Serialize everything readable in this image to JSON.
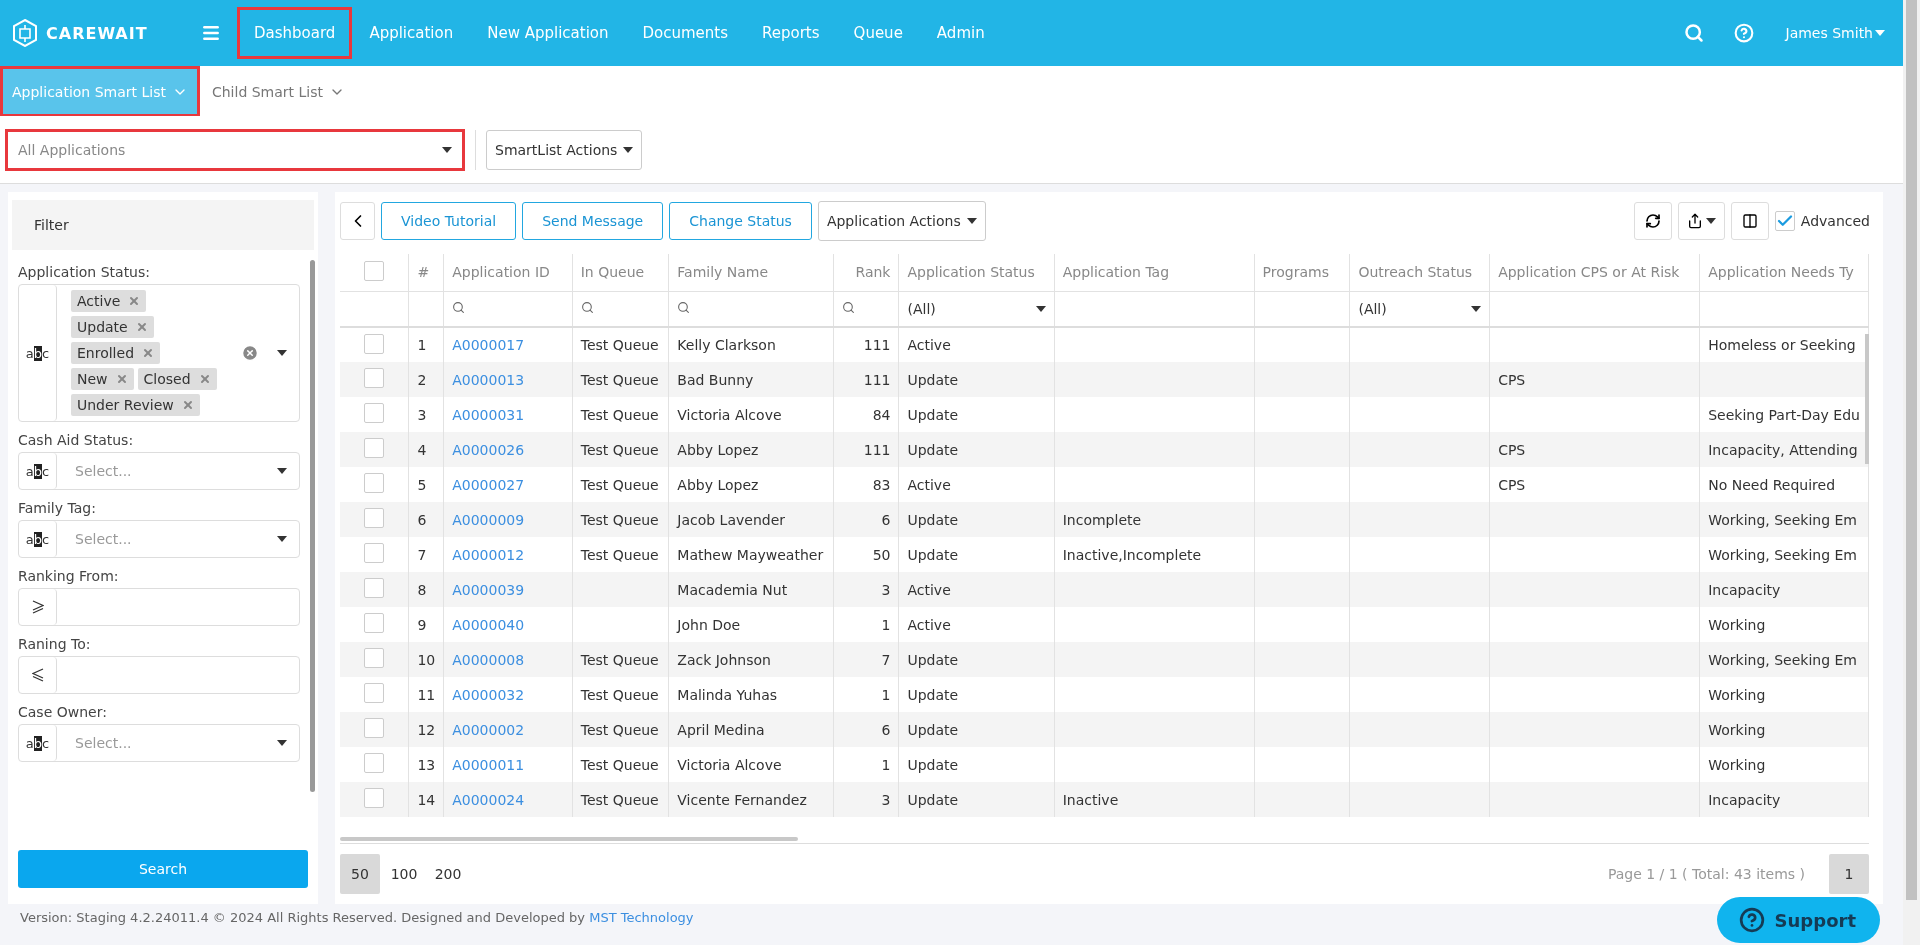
{
  "brand": {
    "name": "CAREWAIT"
  },
  "nav": [
    {
      "label": "Dashboard",
      "highlighted": true
    },
    {
      "label": "Application",
      "highlighted": false
    },
    {
      "label": "New Application",
      "highlighted": false
    },
    {
      "label": "Documents",
      "highlighted": false
    },
    {
      "label": "Reports",
      "highlighted": false
    },
    {
      "label": "Queue",
      "highlighted": false
    },
    {
      "label": "Admin",
      "highlighted": false
    }
  ],
  "user": {
    "name": "James Smith"
  },
  "smart_lists": [
    {
      "label": "Application Smart List",
      "selected": true,
      "highlighted": true
    },
    {
      "label": "Child Smart List",
      "selected": false,
      "highlighted": false
    }
  ],
  "list_select": {
    "value": "All Applications",
    "highlighted": true
  },
  "smartlist_actions": "SmartList Actions",
  "filter": {
    "title": "Filter",
    "search_button": "Search",
    "fields": [
      {
        "kind": "tags",
        "label": "Application Status:",
        "prefix": "abc",
        "tags": [
          "Active",
          "Update",
          "Enrolled",
          "New",
          "Closed",
          "Under Review"
        ]
      },
      {
        "kind": "select",
        "label": "Cash Aid Status:",
        "prefix": "abc",
        "placeholder": "Select..."
      },
      {
        "kind": "select",
        "label": "Family Tag:",
        "prefix": "abc",
        "placeholder": "Select..."
      },
      {
        "kind": "gte",
        "label": "Ranking From:"
      },
      {
        "kind": "lte",
        "label": "Raning To:"
      },
      {
        "kind": "select",
        "label": "Case Owner:",
        "prefix": "abc",
        "placeholder": "Select..."
      }
    ]
  },
  "toolbar": {
    "buttons": [
      "Video Tutorial",
      "Send Message",
      "Change Status"
    ],
    "actions": "Application Actions",
    "advanced": {
      "label": "Advanced",
      "checked": true
    }
  },
  "table": {
    "all_checked": false,
    "columns": [
      {
        "label": "#",
        "kind": "none"
      },
      {
        "label": "Application ID",
        "kind": "search"
      },
      {
        "label": "In Queue",
        "kind": "search"
      },
      {
        "label": "Family Name",
        "kind": "search"
      },
      {
        "label": "Rank",
        "kind": "search"
      },
      {
        "label": "Application Status",
        "kind": "select",
        "filter_value": "(All)"
      },
      {
        "label": "Application Tag",
        "kind": "none"
      },
      {
        "label": "Programs",
        "kind": "none"
      },
      {
        "label": "Outreach Status",
        "kind": "select",
        "filter_value": "(All)"
      },
      {
        "label": "Application CPS or At Risk",
        "kind": "none"
      },
      {
        "label": "Application Needs Ty",
        "kind": "none"
      }
    ],
    "rows": [
      {
        "checked": false,
        "number": "1",
        "id": "A0000017",
        "queue": "Test Queue",
        "family": "Kelly Clarkson",
        "rank": "111",
        "status": "Active",
        "needs": "Homeless or Seeking"
      },
      {
        "checked": false,
        "number": "2",
        "id": "A0000013",
        "queue": "Test Queue",
        "family": "Bad Bunny",
        "rank": "111",
        "status": "Update",
        "cps": "CPS"
      },
      {
        "checked": false,
        "number": "3",
        "id": "A0000031",
        "queue": "Test Queue",
        "family": "Victoria Alcove",
        "rank": "84",
        "status": "Update",
        "needs": "Seeking Part-Day Edu"
      },
      {
        "checked": false,
        "number": "4",
        "id": "A0000026",
        "queue": "Test Queue",
        "family": "Abby Lopez",
        "rank": "111",
        "status": "Update",
        "cps": "CPS",
        "needs": "Incapacity, Attending"
      },
      {
        "checked": false,
        "number": "5",
        "id": "A0000027",
        "queue": "Test Queue",
        "family": "Abby Lopez",
        "rank": "83",
        "status": "Active",
        "cps": "CPS",
        "needs": "No Need Required"
      },
      {
        "checked": false,
        "number": "6",
        "id": "A0000009",
        "queue": "Test Queue",
        "family": "Jacob Lavender",
        "rank": "6",
        "status": "Update",
        "tag": "Incomplete",
        "needs": "Working, Seeking Em"
      },
      {
        "checked": false,
        "number": "7",
        "id": "A0000012",
        "queue": "Test Queue",
        "family": "Mathew Mayweather",
        "rank": "50",
        "status": "Update",
        "tag": "Inactive,Incomplete",
        "needs": "Working, Seeking Em"
      },
      {
        "checked": false,
        "number": "8",
        "id": "A0000039",
        "family": "Macademia Nut",
        "rank": "3",
        "status": "Active",
        "needs": "Incapacity"
      },
      {
        "checked": false,
        "number": "9",
        "id": "A0000040",
        "family": "John Doe",
        "rank": "1",
        "status": "Active",
        "needs": "Working"
      },
      {
        "checked": false,
        "number": "10",
        "id": "A0000008",
        "queue": "Test Queue",
        "family": "Zack Johnson",
        "rank": "7",
        "status": "Update",
        "needs": "Working, Seeking Em"
      },
      {
        "checked": false,
        "number": "11",
        "id": "A0000032",
        "queue": "Test Queue",
        "family": "Malinda Yuhas",
        "rank": "1",
        "status": "Update",
        "needs": "Working"
      },
      {
        "checked": false,
        "number": "12",
        "id": "A0000002",
        "queue": "Test Queue",
        "family": "April Medina",
        "rank": "6",
        "status": "Update",
        "needs": "Working"
      },
      {
        "checked": false,
        "number": "13",
        "id": "A0000011",
        "queue": "Test Queue",
        "family": "Victoria Alcove",
        "rank": "1",
        "status": "Update",
        "needs": "Working"
      },
      {
        "checked": false,
        "number": "14",
        "id": "A0000024",
        "queue": "Test Queue",
        "family": "Vicente Fernandez",
        "rank": "3",
        "status": "Update",
        "tag": "Inactive",
        "needs": "Incapacity"
      }
    ]
  },
  "pager": {
    "sizes": [
      {
        "label": "50",
        "selected": true
      },
      {
        "label": "100",
        "selected": false
      },
      {
        "label": "200",
        "selected": false
      }
    ],
    "summary": "Page 1 / 1 ( Total: 43 items )",
    "pages": [
      {
        "label": "1",
        "selected": true
      }
    ]
  },
  "support": {
    "label": "Support"
  },
  "footer": {
    "text": "Version: Staging 4.2.24011.4 © 2024 All Rights Reserved. Designed and Developed by",
    "link": "MST Technology"
  }
}
